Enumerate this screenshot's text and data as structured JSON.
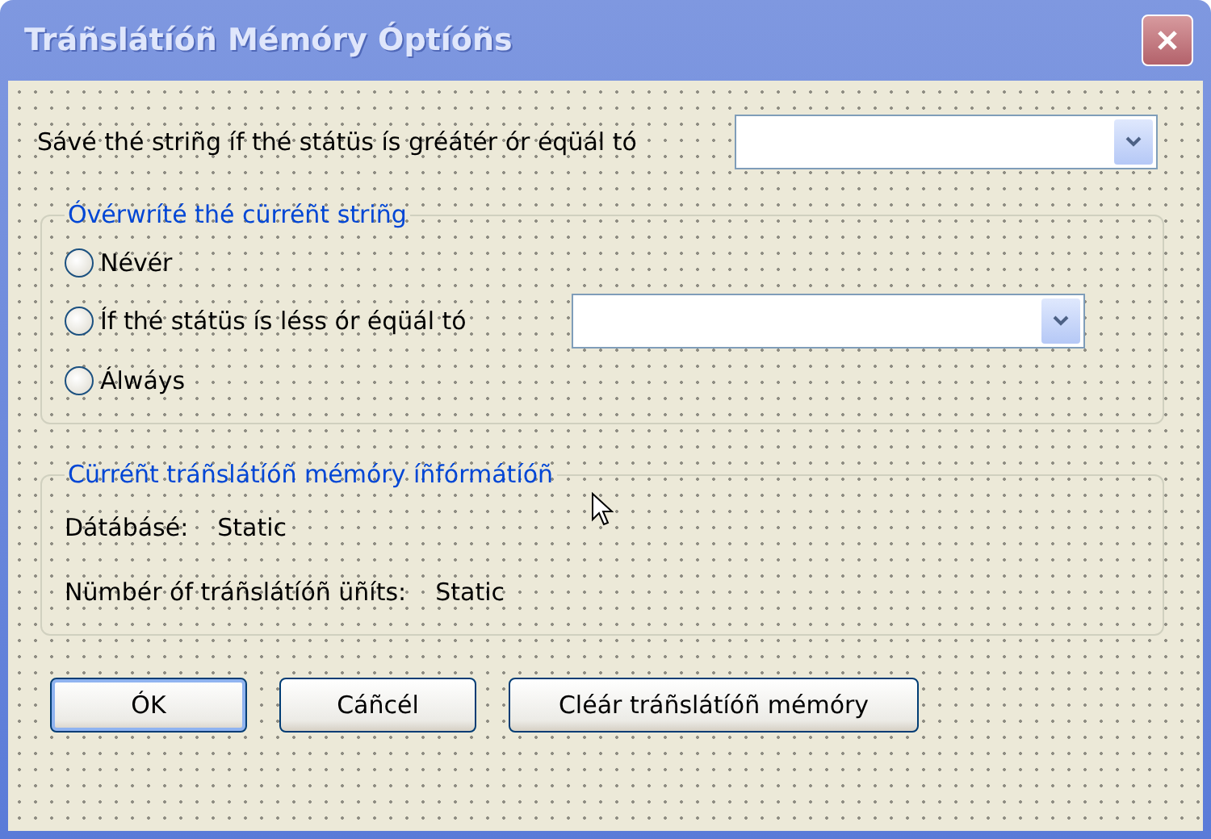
{
  "window": {
    "title": "Tráñslátíóñ Mémóry Óptíóñs"
  },
  "save_threshold": {
    "label": "Sávé thé striñg íf thé státüs ís gréátér ór éqüál tó"
  },
  "overwrite_group": {
    "title": "Óvérwríté thé cürréñt striñg",
    "options": [
      {
        "label": "Névér",
        "selected": false,
        "kind": "plain"
      },
      {
        "label": "Íf thé státüs ís léss ór éqüál tó",
        "selected": false,
        "kind": "dropdown"
      },
      {
        "label": "Álwáys",
        "selected": false,
        "kind": "plain"
      }
    ]
  },
  "info_group": {
    "title": "Cürréñt tráñslátíóñ mémóry íñfórmátíóñ",
    "rows": [
      {
        "label": "Dátábásé:",
        "value": "Static"
      },
      {
        "label": "Nümbér óf tráñslátíóñ üñíts:",
        "value": "Static"
      }
    ]
  },
  "buttons": [
    {
      "label": "ÓK",
      "default": true,
      "kind": "ok"
    },
    {
      "label": "Cáñcél",
      "default": false,
      "kind": "cancel"
    },
    {
      "label": "Cléár tráñslátíóñ mémóry",
      "default": false,
      "kind": "clear"
    }
  ]
}
